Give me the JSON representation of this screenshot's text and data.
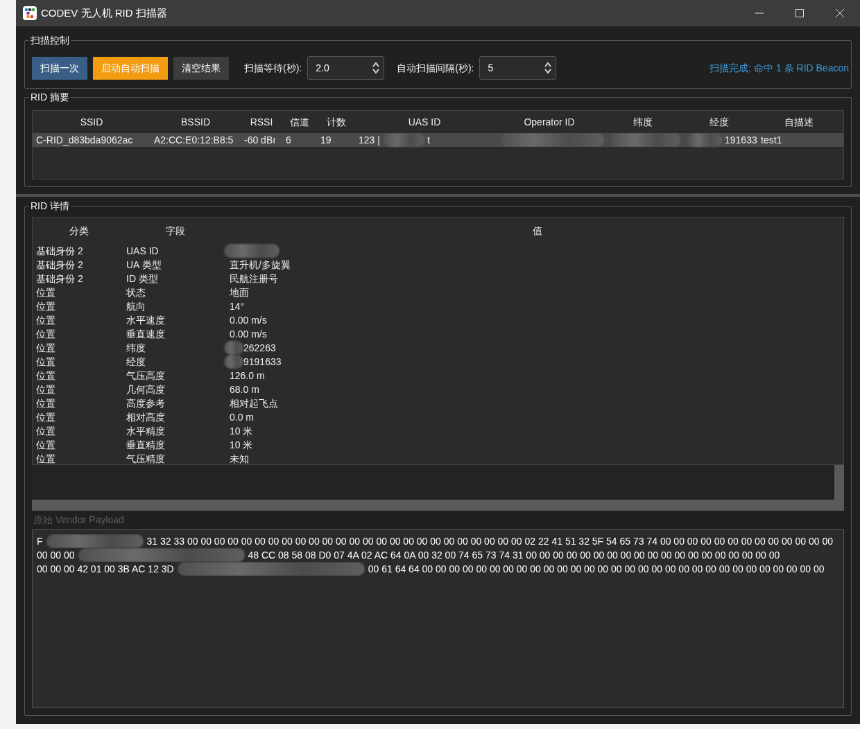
{
  "window": {
    "title": "CODEV 无人机 RID 扫描器"
  },
  "scan_control": {
    "title": "扫描控制",
    "buttons": [
      {
        "label": "扫描一次",
        "kind": "primary"
      },
      {
        "label": "启动自动扫描",
        "kind": "warning"
      },
      {
        "label": "清空结果",
        "kind": "plain"
      }
    ],
    "wait": {
      "label": "扫描等待(秒):",
      "value": "2.0"
    },
    "interval": {
      "label": "自动扫描间隔(秒):",
      "value": "5"
    },
    "status": "扫描完成: 命中 1 条 RID Beacon"
  },
  "summary": {
    "title": "RID 摘要",
    "columns": [
      "SSID",
      "BSSID",
      "RSSI",
      "信道",
      "计数",
      "UAS ID",
      "Operator ID",
      "纬度",
      "经度",
      "自描述"
    ],
    "rows": [
      {
        "selected": true,
        "cells": [
          {
            "text": "C-RID_d83bda9062ac"
          },
          {
            "text": "A2:CC:E0:12:B8:5"
          },
          {
            "text": "-60 dBı"
          },
          {
            "text": "6"
          },
          {
            "text": "19"
          },
          {
            "before": "123 |",
            "after": "t"
          },
          {
            "redacted": true
          },
          {
            "redacted": true
          },
          {
            "after": "191633"
          },
          {
            "text": "test1"
          }
        ]
      }
    ]
  },
  "details": {
    "title": "RID 详情",
    "columns": [
      "分类",
      "字段",
      "值"
    ],
    "rows": [
      {
        "category": "基础身份 2",
        "field": "UAS ID",
        "redacted": true
      },
      {
        "category": "基础身份 2",
        "field": "UA 类型",
        "value": "直升机/多旋翼"
      },
      {
        "category": "基础身份 2",
        "field": "ID 类型",
        "value": "民航注册号"
      },
      {
        "category": "位置",
        "field": "状态",
        "value": "地面"
      },
      {
        "category": "位置",
        "field": "航向",
        "value": "14°"
      },
      {
        "category": "位置",
        "field": "水平速度",
        "value": "0.00 m/s"
      },
      {
        "category": "位置",
        "field": "垂直速度",
        "value": "0.00 m/s"
      },
      {
        "category": "位置",
        "field": "纬度",
        "value": "262263",
        "redacted": true
      },
      {
        "category": "位置",
        "field": "经度",
        "value": "9191633",
        "redacted": true
      },
      {
        "category": "位置",
        "field": "气压高度",
        "value": "126.0 m"
      },
      {
        "category": "位置",
        "field": "几何高度",
        "value": "68.0 m"
      },
      {
        "category": "位置",
        "field": "高度参考",
        "value": "相对起飞点"
      },
      {
        "category": "位置",
        "field": "相对高度",
        "value": "0.0 m"
      },
      {
        "category": "位置",
        "field": "水平精度",
        "value": "10 米"
      },
      {
        "category": "位置",
        "field": "垂直精度",
        "value": "10 米"
      },
      {
        "category": "位置",
        "field": "气压精度",
        "value": "未知"
      }
    ]
  },
  "payload": {
    "label": "原始 Vendor Payload",
    "disabled": true,
    "lines": [
      {
        "before": "F",
        "after": "31 32 33 00 00 00 00 00 00 00 00 00 00 00 00 00 00 00 00 00 00 00 00 00 00 00 00 00 02 22 41 51 32 5F 54 65 73 74 00 00 00 00 00 00 00 00 00 00 00 00 00"
      },
      {
        "before": "00 00 00",
        "after": "48 CC 08 58 08 D0 07 4A 02 AC 64 0A 00 32 00 74 65 73 74 31 00 00 00 00 00 00 00 00 00 00 00 00 00 00 00 00 00 00 00"
      },
      {
        "before": "00 00 00 42 01 00 3B AC 12 3D",
        "after": "00 61 64 64 00 00 00 00 00 00 00 00 00 00 00 00 00 00 00 00 00 00 00 00 00 00 00 00 00 00 00 00 00 00"
      }
    ]
  }
}
